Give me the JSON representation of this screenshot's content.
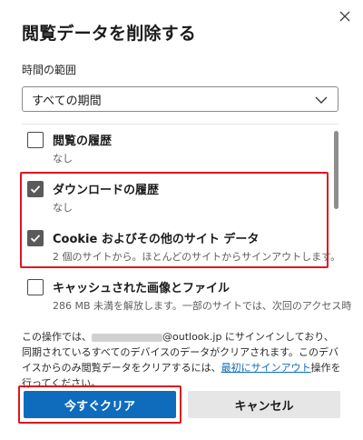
{
  "dialog": {
    "title": "閲覧データを削除する",
    "close_icon": "close-icon"
  },
  "time_range": {
    "label": "時間の範囲",
    "selected": "すべての期間",
    "chevron_icon": "chevron-down-icon"
  },
  "items": [
    {
      "title": "閲覧の履歴",
      "subtitle": "なし",
      "checked": false
    },
    {
      "title": "ダウンロードの履歴",
      "subtitle": "なし",
      "checked": true
    },
    {
      "title": "Cookie およびその他のサイト データ",
      "subtitle": "2 個のサイトから。ほとんどのサイトからサインアウトします。",
      "checked": true
    },
    {
      "title": "キャッシュされた画像とファイル",
      "subtitle": "286 MB 未満を解放します。一部のサイトでは、次回のアクセス時",
      "checked": false
    }
  ],
  "info": {
    "prefix": "この操作では、",
    "email_suffix": "@outlook.jp",
    "middle": " にサインインしており、同期されているすべてのデバイスのデータがクリアされます。このデバイスからのみ閲覧データをクリアするには、",
    "link": "最初にサインアウト",
    "suffix": "操作を行ってください。"
  },
  "buttons": {
    "clear_now": "今すぐクリア",
    "cancel": "キャンセル"
  },
  "colors": {
    "primary": "#0f6cbd",
    "highlight": "#e0141e",
    "checkbox_checked": "#5a5a5a"
  }
}
